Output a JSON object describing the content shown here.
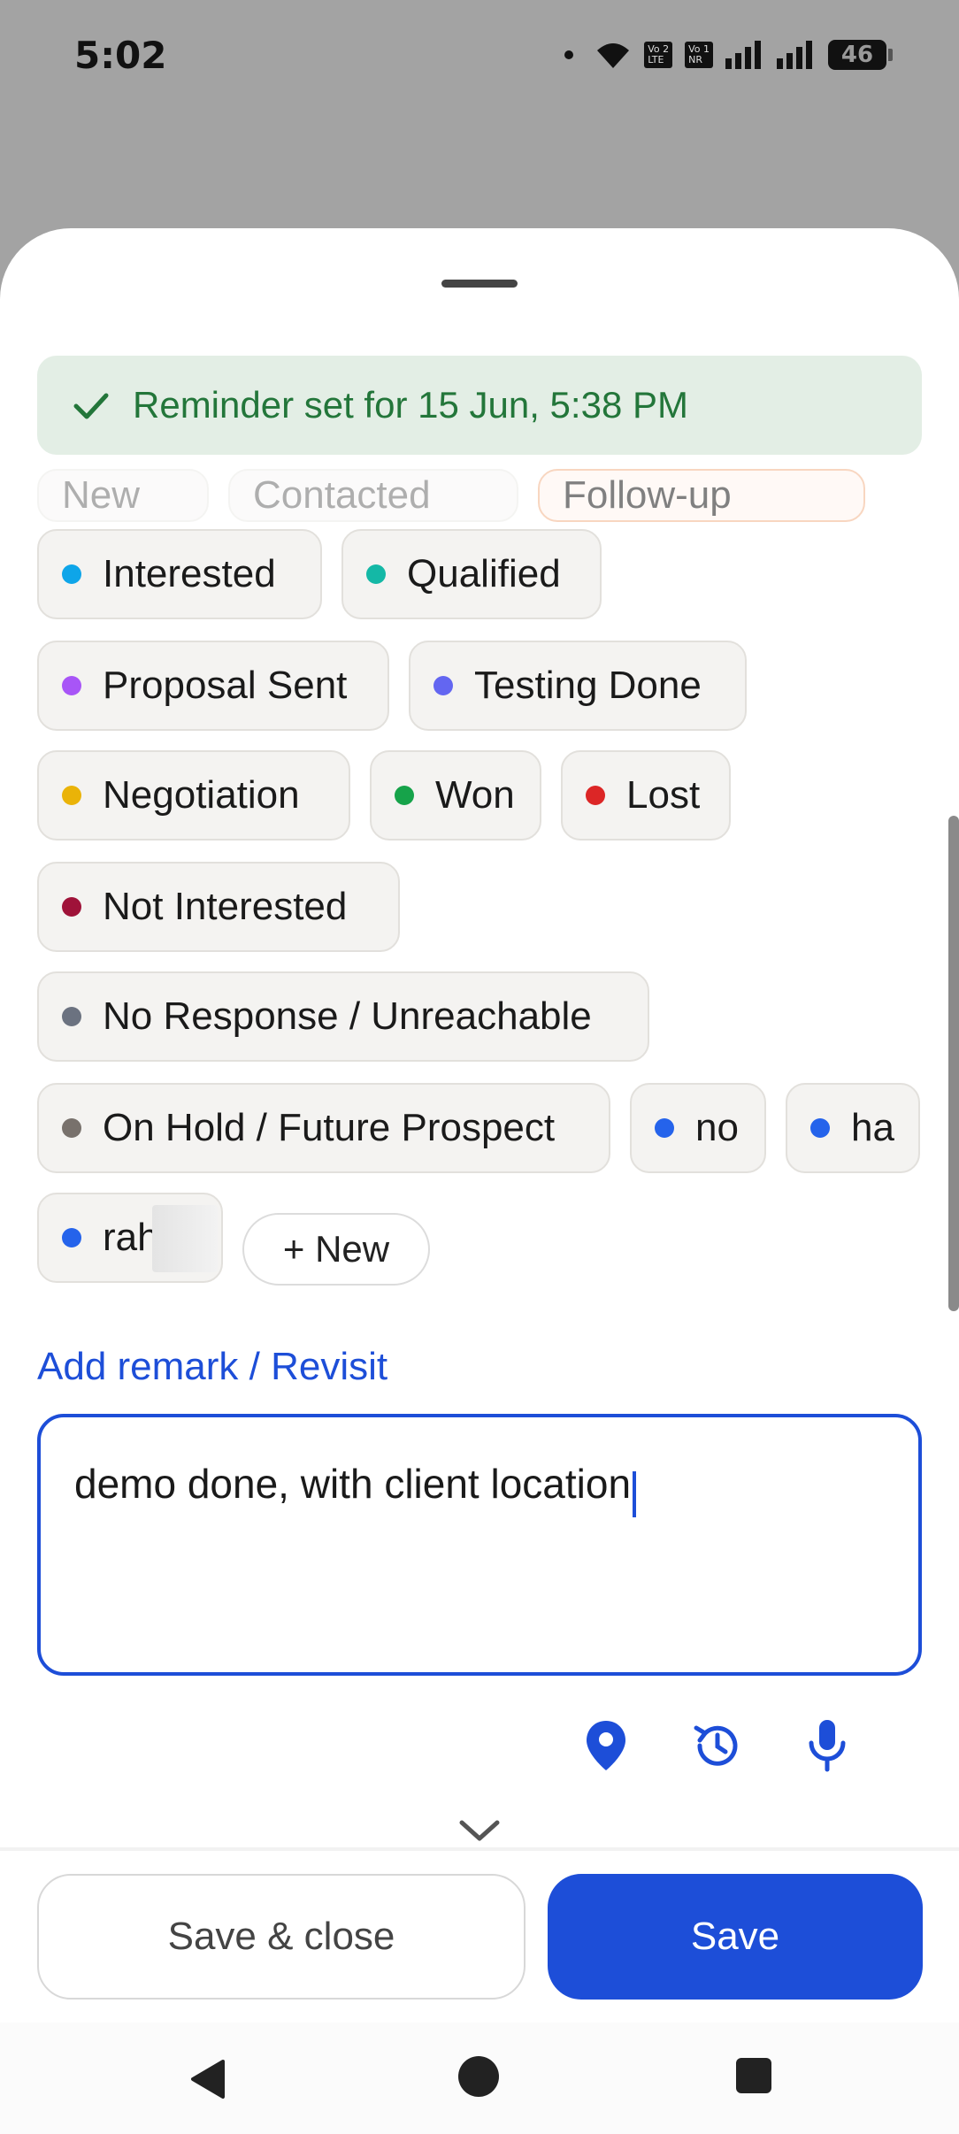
{
  "status_bar": {
    "time": "5:02",
    "sim1": "Vo 2\nLTE",
    "sim2": "Vo 1\nNR",
    "battery": "46"
  },
  "toast": {
    "icon": "check-icon",
    "message": "Reminder set for 15 Jun, 5:38 PM"
  },
  "stages": {
    "partial_top": [
      {
        "label": "New"
      },
      {
        "label": "Contacted"
      },
      {
        "label": "Follow-up"
      }
    ],
    "items": [
      {
        "label": "Interested",
        "color": "#0ea5e9"
      },
      {
        "label": "Qualified",
        "color": "#14b8a6"
      },
      {
        "label": "Proposal Sent",
        "color": "#a855f7"
      },
      {
        "label": "Testing Done",
        "color": "#6366f1"
      },
      {
        "label": "Negotiation",
        "color": "#eab308"
      },
      {
        "label": "Won",
        "color": "#16a34a"
      },
      {
        "label": "Lost",
        "color": "#dc2626"
      },
      {
        "label": "Not Interested",
        "color": "#9f1239"
      },
      {
        "label": "No Response / Unreachable",
        "color": "#6b7280"
      },
      {
        "label": "On Hold / Future Prospect",
        "color": "#78716c"
      },
      {
        "label": "no",
        "color": "#2563eb"
      },
      {
        "label": "ha",
        "color": "#2563eb"
      },
      {
        "label": "rah",
        "color": "#2563eb"
      }
    ],
    "new_button": "+ New"
  },
  "remark": {
    "label": "Add remark / Revisit",
    "value": "demo done, with client location"
  },
  "tools": [
    "location-pin-icon",
    "history-icon",
    "microphone-icon"
  ],
  "footer": {
    "save_close": "Save & close",
    "save": "Save"
  },
  "colors": {
    "accent": "#1d4ed8",
    "toast_bg": "#e3eee5",
    "toast_text": "#23763a"
  }
}
